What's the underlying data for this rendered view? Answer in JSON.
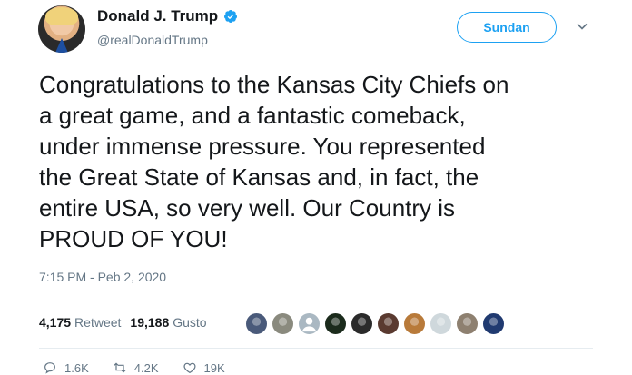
{
  "user": {
    "name": "Donald J. Trump",
    "handle": "@realDonaldTrump"
  },
  "follow_button": {
    "label": "Sundan"
  },
  "tweet": {
    "lines": [
      "Congratulations to the Kansas City Chiefs on",
      "a great game, and a fantastic comeback,",
      "under immense pressure. You represented",
      "the Great State of Kansas and, in fact, the",
      "entire USA, so very well. Our Country is",
      "PROUD OF YOU!"
    ],
    "timestamp": "7:15 PM - Peb 2, 2020"
  },
  "stats": {
    "retweets_count": "4,175",
    "retweets_label": "Retweet",
    "likes_count": "19,188",
    "likes_label": "Gusto"
  },
  "liker_avatars": [
    {
      "icon": "avatar-photo",
      "color": "#4a5a7a"
    },
    {
      "icon": "avatar-photo",
      "color": "#8a8a7e"
    },
    {
      "icon": "default-avatar-icon",
      "color": "#aab8c2"
    },
    {
      "icon": "avatar-photo",
      "color": "#1b2b1c"
    },
    {
      "icon": "avatar-photo",
      "color": "#2b2b2b"
    },
    {
      "icon": "avatar-photo",
      "color": "#5a3a30"
    },
    {
      "icon": "avatar-photo",
      "color": "#b87a3a"
    },
    {
      "icon": "avatar-photo",
      "color": "#cfd8dc"
    },
    {
      "icon": "avatar-photo",
      "color": "#8e8070"
    },
    {
      "icon": "avatar-photo",
      "color": "#203a70"
    }
  ],
  "actions": {
    "replies": "1.6K",
    "retweets": "4.2K",
    "likes": "19K"
  },
  "colors": {
    "accent": "#1da1f2",
    "muted_text": "#657786",
    "divider": "#e6ecf0"
  }
}
